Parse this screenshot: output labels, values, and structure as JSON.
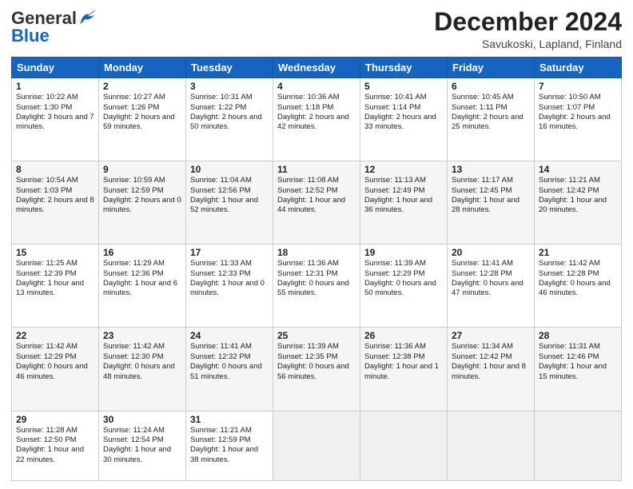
{
  "header": {
    "logo_general": "General",
    "logo_blue": "Blue",
    "month_title": "December 2024",
    "subtitle": "Savukoski, Lapland, Finland"
  },
  "days_of_week": [
    "Sunday",
    "Monday",
    "Tuesday",
    "Wednesday",
    "Thursday",
    "Friday",
    "Saturday"
  ],
  "weeks": [
    [
      {
        "day": "1",
        "info": "Sunrise: 10:22 AM\nSunset: 1:30 PM\nDaylight: 3 hours and 7 minutes."
      },
      {
        "day": "2",
        "info": "Sunrise: 10:27 AM\nSunset: 1:26 PM\nDaylight: 2 hours and 59 minutes."
      },
      {
        "day": "3",
        "info": "Sunrise: 10:31 AM\nSunset: 1:22 PM\nDaylight: 2 hours and 50 minutes."
      },
      {
        "day": "4",
        "info": "Sunrise: 10:36 AM\nSunset: 1:18 PM\nDaylight: 2 hours and 42 minutes."
      },
      {
        "day": "5",
        "info": "Sunrise: 10:41 AM\nSunset: 1:14 PM\nDaylight: 2 hours and 33 minutes."
      },
      {
        "day": "6",
        "info": "Sunrise: 10:45 AM\nSunset: 1:11 PM\nDaylight: 2 hours and 25 minutes."
      },
      {
        "day": "7",
        "info": "Sunrise: 10:50 AM\nSunset: 1:07 PM\nDaylight: 2 hours and 16 minutes."
      }
    ],
    [
      {
        "day": "8",
        "info": "Sunrise: 10:54 AM\nSunset: 1:03 PM\nDaylight: 2 hours and 8 minutes."
      },
      {
        "day": "9",
        "info": "Sunrise: 10:59 AM\nSunset: 12:59 PM\nDaylight: 2 hours and 0 minutes."
      },
      {
        "day": "10",
        "info": "Sunrise: 11:04 AM\nSunset: 12:56 PM\nDaylight: 1 hour and 52 minutes."
      },
      {
        "day": "11",
        "info": "Sunrise: 11:08 AM\nSunset: 12:52 PM\nDaylight: 1 hour and 44 minutes."
      },
      {
        "day": "12",
        "info": "Sunrise: 11:13 AM\nSunset: 12:49 PM\nDaylight: 1 hour and 36 minutes."
      },
      {
        "day": "13",
        "info": "Sunrise: 11:17 AM\nSunset: 12:45 PM\nDaylight: 1 hour and 28 minutes."
      },
      {
        "day": "14",
        "info": "Sunrise: 11:21 AM\nSunset: 12:42 PM\nDaylight: 1 hour and 20 minutes."
      }
    ],
    [
      {
        "day": "15",
        "info": "Sunrise: 11:25 AM\nSunset: 12:39 PM\nDaylight: 1 hour and 13 minutes."
      },
      {
        "day": "16",
        "info": "Sunrise: 11:29 AM\nSunset: 12:36 PM\nDaylight: 1 hour and 6 minutes."
      },
      {
        "day": "17",
        "info": "Sunrise: 11:33 AM\nSunset: 12:33 PM\nDaylight: 1 hour and 0 minutes."
      },
      {
        "day": "18",
        "info": "Sunrise: 11:36 AM\nSunset: 12:31 PM\nDaylight: 0 hours and 55 minutes."
      },
      {
        "day": "19",
        "info": "Sunrise: 11:39 AM\nSunset: 12:29 PM\nDaylight: 0 hours and 50 minutes."
      },
      {
        "day": "20",
        "info": "Sunrise: 11:41 AM\nSunset: 12:28 PM\nDaylight: 0 hours and 47 minutes."
      },
      {
        "day": "21",
        "info": "Sunrise: 11:42 AM\nSunset: 12:28 PM\nDaylight: 0 hours and 46 minutes."
      }
    ],
    [
      {
        "day": "22",
        "info": "Sunrise: 11:42 AM\nSunset: 12:29 PM\nDaylight: 0 hours and 46 minutes."
      },
      {
        "day": "23",
        "info": "Sunrise: 11:42 AM\nSunset: 12:30 PM\nDaylight: 0 hours and 48 minutes."
      },
      {
        "day": "24",
        "info": "Sunrise: 11:41 AM\nSunset: 12:32 PM\nDaylight: 0 hours and 51 minutes."
      },
      {
        "day": "25",
        "info": "Sunrise: 11:39 AM\nSunset: 12:35 PM\nDaylight: 0 hours and 56 minutes."
      },
      {
        "day": "26",
        "info": "Sunrise: 11:36 AM\nSunset: 12:38 PM\nDaylight: 1 hour and 1 minute."
      },
      {
        "day": "27",
        "info": "Sunrise: 11:34 AM\nSunset: 12:42 PM\nDaylight: 1 hour and 8 minutes."
      },
      {
        "day": "28",
        "info": "Sunrise: 11:31 AM\nSunset: 12:46 PM\nDaylight: 1 hour and 15 minutes."
      }
    ],
    [
      {
        "day": "29",
        "info": "Sunrise: 11:28 AM\nSunset: 12:50 PM\nDaylight: 1 hour and 22 minutes."
      },
      {
        "day": "30",
        "info": "Sunrise: 11:24 AM\nSunset: 12:54 PM\nDaylight: 1 hour and 30 minutes."
      },
      {
        "day": "31",
        "info": "Sunrise: 11:21 AM\nSunset: 12:59 PM\nDaylight: 1 hour and 38 minutes."
      },
      null,
      null,
      null,
      null
    ]
  ]
}
